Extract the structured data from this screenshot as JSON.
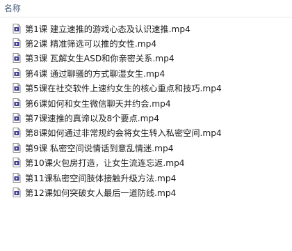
{
  "header": {
    "name_label": "名称"
  },
  "files": [
    {
      "name": "第1课 建立速推的游戏心态及认识速推.mp4",
      "icon": "video-file-icon"
    },
    {
      "name": "第2课 精准筛选可以推的女性.mp4",
      "icon": "video-file-icon"
    },
    {
      "name": "第3课 瓦解女生ASD和你亲密关系.mp4",
      "icon": "video-file-icon"
    },
    {
      "name": "第4课 通过聊骚的方式聊湿女生.mp4",
      "icon": "video-file-icon"
    },
    {
      "name": "第5课在社交软件上速约女生的核心重点和技巧.mp4",
      "icon": "video-file-icon"
    },
    {
      "name": "第6课如何和女生微信聊天并约会.mp4",
      "icon": "video-file-icon"
    },
    {
      "name": "第7课速推的真谛以及8个要点.mp4",
      "icon": "video-file-icon"
    },
    {
      "name": "第8课如何通过非常规约会将女生转入私密空间.mp4",
      "icon": "video-file-icon"
    },
    {
      "name": "第9课 私密空间说情话到意乱情迷.mp4",
      "icon": "video-file-icon"
    },
    {
      "name": "第10课火包房打造，让女生流连忘返.mp4",
      "icon": "video-file-icon"
    },
    {
      "name": "第11课私密空间肢体接触升级方法.mp4",
      "icon": "video-file-icon"
    },
    {
      "name": "第12课如何突破女人最后一道防线.mp4",
      "icon": "video-file-icon"
    }
  ],
  "colors": {
    "header_text": "#4c607a",
    "icon_body": "#ffffff",
    "icon_border": "#8a8a8a",
    "icon_accent": "#3b3b8f"
  }
}
